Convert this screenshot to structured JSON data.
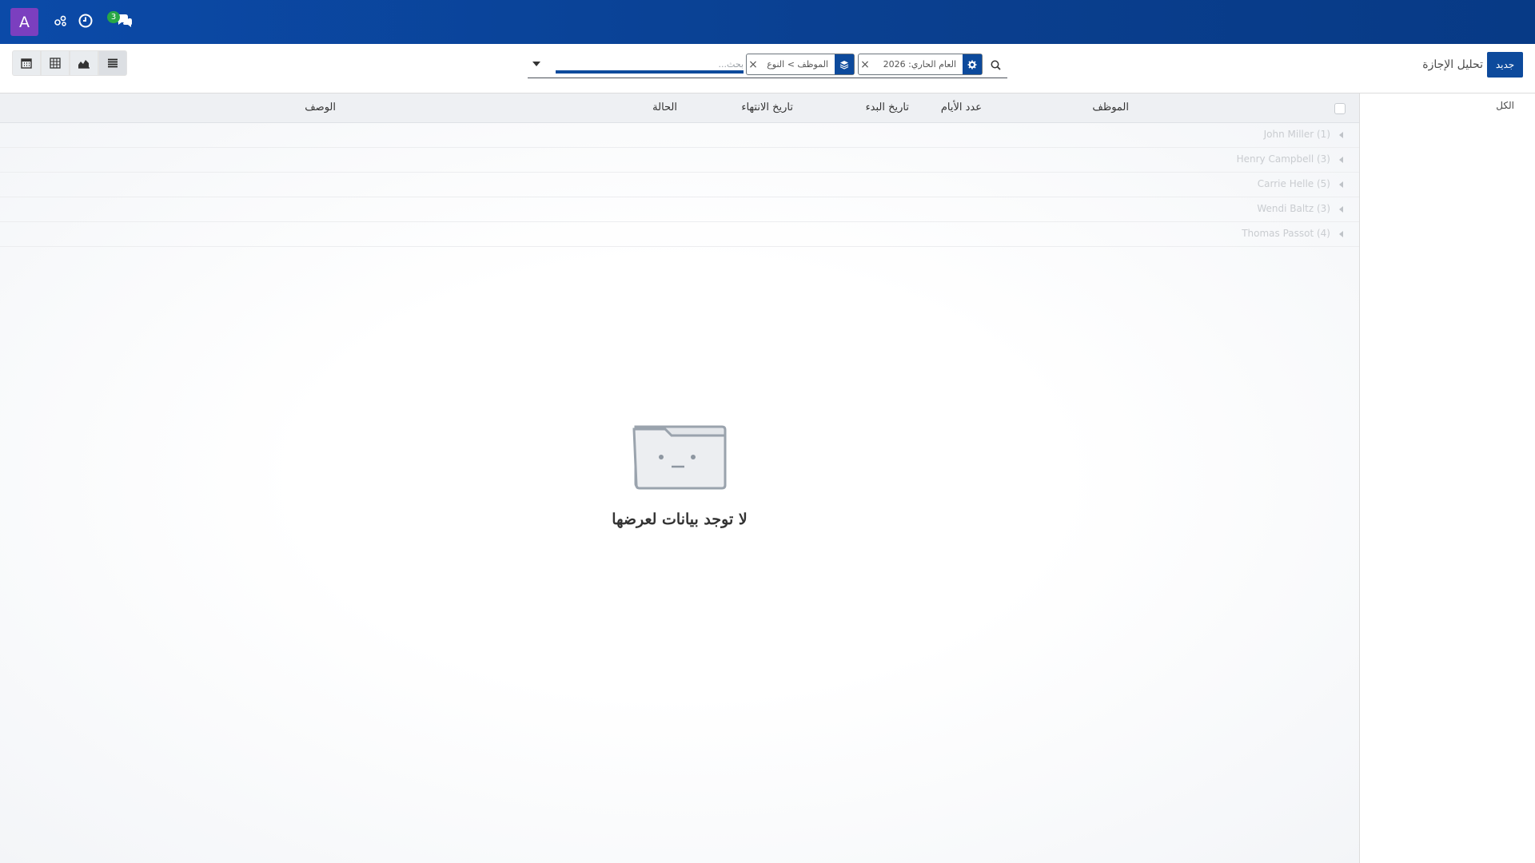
{
  "navbar": {
    "avatar_letter": "A",
    "messages_badge": "3",
    "icons": [
      "activity-icon",
      "clock-icon",
      "chat-icon"
    ]
  },
  "control_panel": {
    "new_button": "جديد",
    "breadcrumb": "تحليل الإجازة",
    "search": {
      "placeholder": "بحث...",
      "filter_facet": "العام الحاري: 2026",
      "group_facet": "الموظف > النوع"
    },
    "view_switcher": [
      "calendar-view",
      "pivot-view",
      "graph-view",
      "list-view"
    ]
  },
  "sidepanel": {
    "items": [
      "الكل"
    ]
  },
  "table": {
    "columns": {
      "employee": "الموظف",
      "days": "عدد الأيام",
      "start_date": "تاريخ البدء",
      "end_date": "تاريخ الانتهاء",
      "status": "الحالة",
      "description": "الوصف"
    },
    "groups": [
      "John Miller (1)",
      "Henry Campbell (3)",
      "Carrie Helle (5)",
      "Wendi Baltz (3)",
      "Thomas Passot (4)"
    ]
  },
  "empty_state": {
    "title": "لا توجد بيانات لعرضها"
  },
  "colors": {
    "navbar": "#0b4aa8",
    "primary": "#0d4a9c",
    "avatar": "#7b3fbf",
    "badge": "#28a745"
  }
}
